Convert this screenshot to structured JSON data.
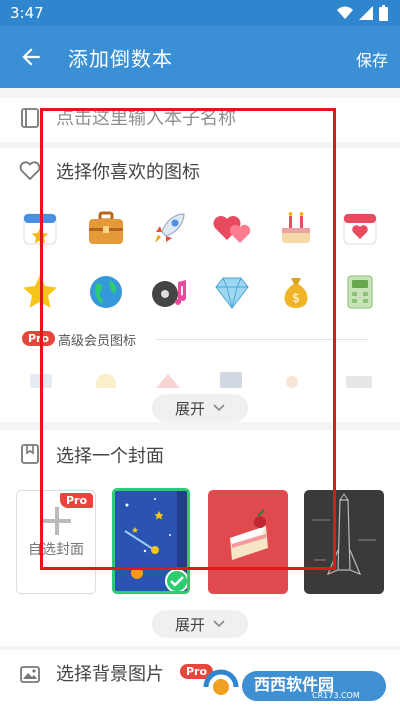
{
  "status_bar": {
    "time": "3:47"
  },
  "app_bar": {
    "title": "添加倒数本",
    "save_label": "保存"
  },
  "name_input": {
    "placeholder": "点击这里输入本子名称"
  },
  "icon_section": {
    "title": "选择你喜欢的图标",
    "icons_row1": [
      "calendar-star-icon",
      "briefcase-icon",
      "rocket-icon",
      "hearts-icon",
      "birthday-cake-icon",
      "calendar-heart-icon"
    ],
    "icons_row2": [
      "star-icon",
      "globe-icon",
      "music-disc-icon",
      "diamond-icon",
      "money-bag-icon",
      "calculator-icon"
    ],
    "pro_badge": "Pro",
    "premium_label": "高级会员图标",
    "expand_label": "展开"
  },
  "cover_section": {
    "title": "选择一个封面",
    "custom_cover_label": "自选封面",
    "pro_badge": "Pro",
    "covers": [
      "custom-cover",
      "space-cover",
      "cake-cover",
      "blueprint-cover"
    ],
    "selected_index": 1,
    "expand_label": "展开"
  },
  "background_section": {
    "title": "选择背景图片",
    "pro_badge": "Pro"
  },
  "watermark": {
    "text": "西西软件园",
    "sub": "CR173.COM"
  },
  "colors": {
    "primary": "#3b8fd4",
    "status": "#2f86cf",
    "pro": "#e8463d",
    "overlay": "#e2161b",
    "check": "#2ecc71"
  }
}
